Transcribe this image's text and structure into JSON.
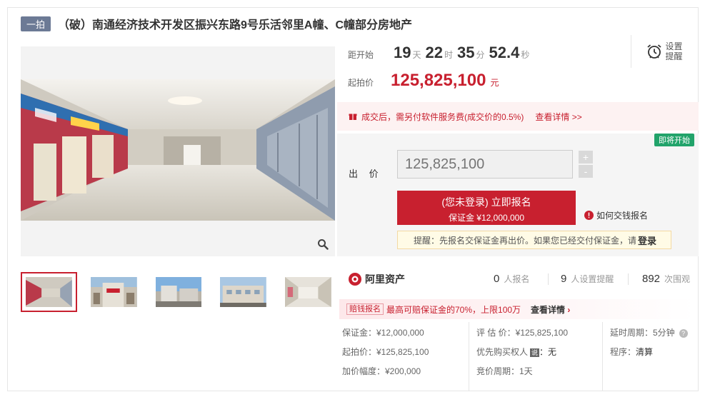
{
  "header": {
    "tag": "一拍",
    "title": "（破）南通经济技术开发区振兴东路9号乐活邻里A幢、C幢部分房地产"
  },
  "countdown": {
    "label": "距开始",
    "days": "19",
    "days_unit": "天",
    "hours": "22",
    "hours_unit": "时",
    "minutes": "35",
    "minutes_unit": "分",
    "seconds": "52.4",
    "seconds_unit": "秒"
  },
  "start_price": {
    "label": "起拍价",
    "value": "125,825,100",
    "unit": "元"
  },
  "reminder": {
    "icon": "alarm-clock-icon",
    "label": "设置提醒"
  },
  "fee_notice": {
    "text": "成交后，需另付软件服务费(成交价的0.5%)",
    "link": "查看详情 >>"
  },
  "bid": {
    "badge": "即将开始",
    "label": "出 价",
    "placeholder": "125,825,100",
    "plus": "+",
    "minus": "-",
    "signup_main": "(您未登录) 立即报名",
    "signup_sub": "保证金 ¥12,000,000",
    "how_deposit": "如何交钱报名",
    "tip_prefix": "提醒：先报名交保证金再出价。如果您已经交付保证金，请",
    "tip_login": "登录"
  },
  "stats": {
    "brand": "阿里资产",
    "signups_num": "0",
    "signups_unit": "人报名",
    "reminders_num": "9",
    "reminders_unit": "人设置提醒",
    "views_num": "892",
    "views_unit": "次围观"
  },
  "promo": {
    "tag": "赔钱报名",
    "text": "最高可赔保证金的70%，上限100万",
    "link": "查看详情"
  },
  "info": {
    "deposit": "保证金：¥12,000,000",
    "start_price": "起拍价：¥125,825,100",
    "increment": "加价幅度：¥200,000",
    "appraisal": "评 估 价：¥125,825,100",
    "priority_label": "优先购买权人",
    "priority_badge": "说",
    "priority_value": "：无",
    "cycle": "竞价周期：1天",
    "delay": "延时周期：5分钟",
    "procedure_label": "程序：",
    "procedure_value": "清算"
  },
  "colors": {
    "accent_red": "#c8202f",
    "tag_bg": "#6c7a95",
    "badge_green": "#21a36a"
  },
  "gallery": {
    "thumb_count": 5,
    "active_index": 0
  }
}
